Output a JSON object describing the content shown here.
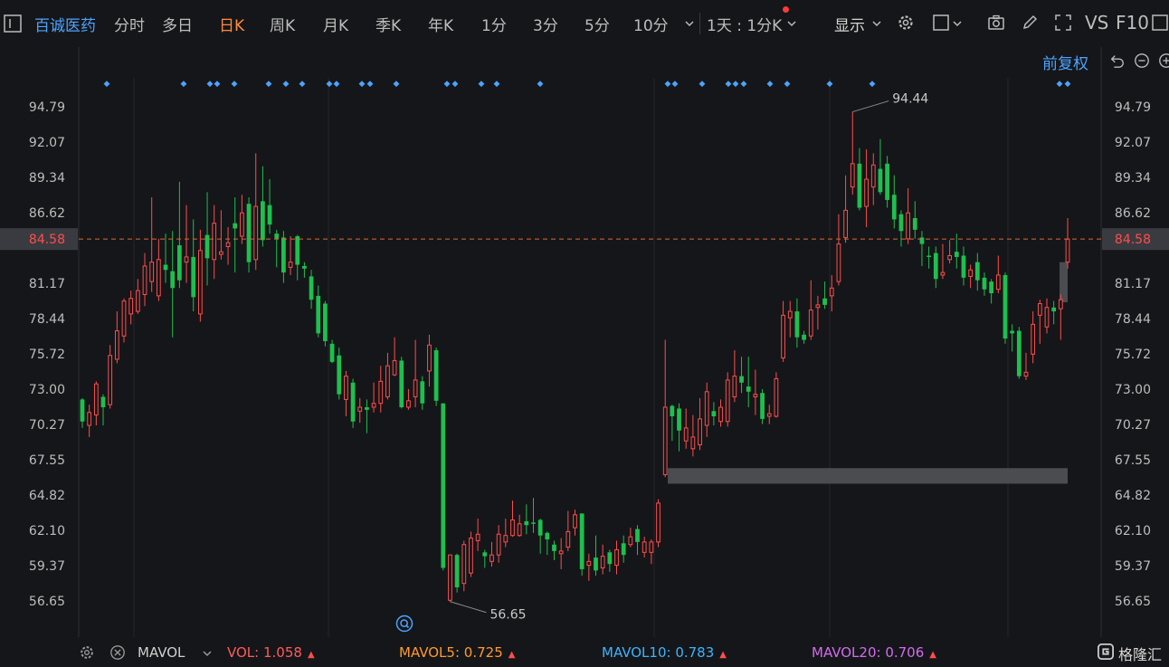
{
  "toolbar": {
    "stock_name": "百诚医药",
    "periods": [
      "分时",
      "多日",
      "日K",
      "周K",
      "月K",
      "季K",
      "年K",
      "1分",
      "3分",
      "5分",
      "10分"
    ],
    "active_period": "日K",
    "interval": "1天 : 1分K",
    "display": "显示",
    "vs": "VS",
    "f10": "F10",
    "adjust": "前复权"
  },
  "chart_data": {
    "type": "candlestick",
    "y_ticks": [
      "94.79",
      "92.07",
      "89.34",
      "86.62",
      "81.17",
      "78.44",
      "75.72",
      "73.00",
      "70.27",
      "67.55",
      "64.82",
      "62.10",
      "59.37",
      "56.65"
    ],
    "ylim": [
      55.2,
      97.4
    ],
    "current_price": "84.58",
    "high_label": "94.44",
    "low_label": "56.65",
    "candles": [
      [
        72.2,
        70.5,
        72.3,
        70.0
      ],
      [
        70.2,
        71.2,
        71.8,
        69.3
      ],
      [
        71.0,
        73.4,
        73.6,
        70.2
      ],
      [
        72.4,
        71.6,
        72.6,
        70.2
      ],
      [
        71.8,
        75.6,
        76.4,
        71.5
      ],
      [
        75.3,
        77.5,
        79.0,
        75.0
      ],
      [
        77.1,
        79.8,
        80.0,
        76.6
      ],
      [
        78.8,
        80.0,
        80.6,
        78.0
      ],
      [
        79.0,
        80.6,
        81.5,
        78.8
      ],
      [
        80.3,
        82.5,
        83.5,
        79.4
      ],
      [
        81.3,
        82.8,
        87.8,
        80.5
      ],
      [
        80.2,
        83.0,
        84.6,
        79.8
      ],
      [
        82.6,
        82.2,
        85.0,
        81.2
      ],
      [
        82.1,
        80.8,
        85.2,
        77.0
      ],
      [
        84.1,
        81.4,
        89.0,
        80.8
      ],
      [
        82.8,
        83.2,
        87.2,
        81.2
      ],
      [
        83.2,
        80.1,
        86.1,
        79.0
      ],
      [
        78.8,
        83.7,
        85.3,
        78.2
      ],
      [
        84.9,
        83.1,
        88.2,
        81.0
      ],
      [
        83.0,
        85.8,
        87.2,
        81.5
      ],
      [
        83.4,
        83.6,
        86.8,
        83.0
      ],
      [
        84.0,
        84.3,
        85.5,
        82.6
      ],
      [
        85.8,
        85.4,
        87.8,
        82.0
      ],
      [
        84.8,
        86.6,
        88.0,
        84.2
      ],
      [
        87.3,
        82.8,
        87.8,
        82.0
      ],
      [
        83.0,
        87.1,
        91.2,
        82.2
      ],
      [
        87.5,
        84.5,
        90.2,
        84.0
      ],
      [
        87.2,
        85.7,
        89.2,
        85.0
      ],
      [
        85.0,
        84.6,
        85.3,
        82.4
      ],
      [
        84.7,
        82.0,
        85.2,
        81.2
      ],
      [
        82.4,
        82.8,
        84.8,
        81.8
      ],
      [
        84.8,
        82.6,
        84.9,
        81.4
      ],
      [
        82.5,
        82.3,
        82.8,
        81.6
      ],
      [
        81.7,
        79.9,
        82.2,
        79.2
      ],
      [
        80.2,
        77.3,
        81.0,
        77.0
      ],
      [
        79.6,
        76.7,
        79.8,
        76.3
      ],
      [
        76.5,
        75.1,
        76.8,
        75.0
      ],
      [
        75.6,
        72.6,
        76.2,
        72.2
      ],
      [
        72.2,
        74.0,
        74.4,
        70.9
      ],
      [
        73.5,
        70.5,
        73.8,
        70.0
      ],
      [
        71.3,
        71.6,
        72.3,
        70.4
      ],
      [
        71.6,
        71.4,
        72.2,
        69.6
      ],
      [
        71.6,
        71.9,
        73.5,
        71.2
      ],
      [
        71.9,
        73.6,
        74.8,
        71.2
      ],
      [
        72.4,
        74.8,
        75.8,
        72.2
      ],
      [
        74.1,
        75.2,
        77.0,
        74.0
      ],
      [
        75.2,
        71.6,
        75.5,
        71.5
      ],
      [
        71.6,
        72.1,
        73.0,
        71.4
      ],
      [
        72.4,
        73.7,
        76.8,
        71.6
      ],
      [
        73.6,
        71.9,
        74.0,
        71.4
      ],
      [
        74.4,
        76.4,
        77.2,
        73.2
      ],
      [
        76.0,
        72.1,
        76.2,
        71.7
      ],
      [
        71.9,
        59.2,
        71.9,
        59.0
      ],
      [
        56.7,
        60.2,
        60.2,
        56.6
      ],
      [
        60.2,
        57.7,
        60.3,
        57.3
      ],
      [
        58.0,
        61.0,
        61.3,
        57.4
      ],
      [
        58.8,
        61.5,
        62.0,
        58.5
      ],
      [
        61.3,
        61.8,
        63.0,
        60.5
      ],
      [
        60.4,
        60.1,
        60.6,
        59.2
      ],
      [
        59.7,
        60.2,
        61.2,
        59.3
      ],
      [
        60.2,
        61.8,
        62.5,
        59.6
      ],
      [
        61.2,
        61.7,
        63.0,
        60.8
      ],
      [
        61.7,
        62.9,
        64.4,
        61.6
      ],
      [
        61.7,
        62.6,
        63.3,
        61.6
      ],
      [
        62.8,
        62.5,
        64.1,
        61.8
      ],
      [
        62.7,
        62.6,
        64.6,
        61.9
      ],
      [
        62.9,
        61.7,
        63.0,
        60.3
      ],
      [
        61.9,
        61.4,
        62.0,
        60.2
      ],
      [
        61.0,
        60.5,
        61.3,
        59.8
      ],
      [
        60.3,
        60.5,
        61.5,
        59.1
      ],
      [
        60.8,
        62.0,
        63.6,
        60.5
      ],
      [
        62.3,
        63.3,
        63.7,
        61.7
      ],
      [
        63.4,
        59.1,
        63.4,
        58.6
      ],
      [
        59.4,
        59.7,
        60.3,
        58.2
      ],
      [
        60.0,
        59.0,
        61.7,
        58.6
      ],
      [
        59.2,
        60.1,
        61.0,
        58.7
      ],
      [
        60.4,
        59.5,
        60.6,
        58.9
      ],
      [
        59.4,
        60.6,
        61.3,
        58.7
      ],
      [
        61.1,
        60.2,
        61.7,
        59.6
      ],
      [
        61.0,
        61.6,
        62.3,
        60.8
      ],
      [
        62.2,
        61.2,
        62.5,
        60.2
      ],
      [
        60.4,
        61.2,
        61.6,
        60.0
      ],
      [
        60.4,
        61.2,
        61.4,
        59.5
      ],
      [
        61.2,
        64.2,
        64.5,
        60.8
      ],
      [
        66.4,
        71.6,
        76.8,
        66.2
      ],
      [
        71.7,
        70.9,
        71.8,
        69.0
      ],
      [
        71.5,
        69.8,
        71.9,
        68.2
      ],
      [
        69.0,
        70.0,
        71.5,
        68.4
      ],
      [
        68.4,
        69.3,
        71.0,
        67.8
      ],
      [
        68.7,
        70.7,
        72.3,
        68.3
      ],
      [
        70.2,
        72.8,
        73.5,
        69.3
      ],
      [
        71.3,
        70.9,
        72.0,
        70.2
      ],
      [
        70.5,
        71.6,
        72.2,
        70.1
      ],
      [
        70.5,
        73.7,
        74.3,
        70.1
      ],
      [
        72.4,
        74.0,
        76.0,
        72.0
      ],
      [
        74.0,
        73.5,
        75.5,
        72.7
      ],
      [
        73.2,
        72.8,
        75.5,
        71.6
      ],
      [
        72.4,
        72.6,
        74.5,
        71.0
      ],
      [
        72.7,
        70.7,
        73.0,
        70.3
      ],
      [
        70.9,
        71.1,
        71.8,
        70.3
      ],
      [
        70.9,
        73.8,
        74.3,
        70.8
      ],
      [
        75.4,
        78.7,
        79.8,
        75.1
      ],
      [
        78.5,
        79.0,
        79.8,
        77.0
      ],
      [
        79.0,
        77.0,
        80.0,
        76.2
      ],
      [
        77.2,
        76.8,
        77.5,
        76.5
      ],
      [
        77.1,
        79.1,
        81.4,
        76.8
      ],
      [
        79.3,
        79.5,
        80.2,
        77.6
      ],
      [
        80.0,
        79.5,
        81.3,
        79.2
      ],
      [
        80.2,
        80.8,
        81.8,
        79.0
      ],
      [
        81.3,
        84.2,
        86.5,
        81.0
      ],
      [
        84.7,
        86.8,
        89.5,
        84.3
      ],
      [
        88.6,
        90.4,
        94.4,
        88.0
      ],
      [
        90.4,
        87.0,
        91.6,
        86.8
      ],
      [
        87.1,
        89.2,
        91.5,
        85.5
      ],
      [
        88.6,
        90.3,
        91.2,
        87.2
      ],
      [
        90.0,
        88.2,
        92.3,
        88.0
      ],
      [
        90.4,
        87.6,
        91.0,
        87.0
      ],
      [
        88.0,
        86.1,
        89.5,
        85.4
      ],
      [
        86.5,
        85.2,
        86.8,
        84.0
      ],
      [
        84.6,
        86.6,
        88.5,
        84.2
      ],
      [
        86.2,
        85.3,
        87.5,
        84.6
      ],
      [
        84.7,
        84.2,
        85.2,
        82.5
      ],
      [
        83.3,
        83.2,
        84.0,
        82.3
      ],
      [
        83.5,
        81.5,
        84.0,
        80.8
      ],
      [
        81.8,
        82.0,
        84.2,
        81.5
      ],
      [
        83.0,
        83.3,
        84.5,
        82.7
      ],
      [
        83.6,
        83.2,
        85.0,
        82.3
      ],
      [
        83.3,
        81.6,
        84.0,
        81.0
      ],
      [
        81.7,
        82.2,
        82.6,
        80.8
      ],
      [
        82.8,
        81.4,
        83.5,
        80.6
      ],
      [
        81.6,
        80.7,
        82.0,
        80.2
      ],
      [
        81.3,
        80.4,
        81.5,
        79.6
      ],
      [
        80.7,
        81.8,
        83.3,
        80.4
      ],
      [
        81.8,
        76.9,
        82.0,
        76.5
      ],
      [
        77.5,
        77.3,
        78.0,
        75.9
      ],
      [
        77.5,
        74.0,
        77.8,
        73.8
      ],
      [
        74.0,
        74.3,
        75.8,
        73.7
      ],
      [
        75.7,
        78.0,
        79.0,
        75.0
      ],
      [
        78.7,
        79.6,
        79.9,
        76.5
      ],
      [
        77.8,
        79.3,
        80.0,
        77.3
      ],
      [
        79.3,
        79.0,
        79.8,
        78.0
      ],
      [
        79.2,
        79.9,
        80.3,
        76.8
      ],
      [
        82.8,
        84.58,
        86.2,
        82.3
      ]
    ],
    "markers": [
      "◆",
      "◆",
      "◆",
      "◆",
      "◆",
      "◆",
      "◆",
      "◆",
      "◆",
      "◆",
      "◆",
      "◆",
      "◆",
      "◆",
      "◆",
      "◆",
      "◆",
      "◆",
      "◆",
      "◆",
      "◆",
      "◆",
      "◆",
      "◆",
      "◆",
      "◆",
      "◆",
      "◆",
      "◆",
      "◆",
      "◆",
      "◆",
      "◆"
    ],
    "indicator_name": "MAVOL",
    "vol": {
      "label": "VOL:",
      "value": "1.058"
    },
    "mavol5": {
      "label": "MAVOL5:",
      "value": "0.725"
    },
    "mavol10": {
      "label": "MAVOL10:",
      "value": "0.783"
    },
    "mavol20": {
      "label": "MAVOL20:",
      "value": "0.706"
    }
  },
  "brand": "格隆汇",
  "colors": {
    "up": "#ff4d4d",
    "down": "#1fbf4f",
    "blue": "#4da3ff",
    "active": "#ff8a3d",
    "mavol5": "#ff9a2e",
    "mavol10": "#3db4ff",
    "mavol20": "#d36bf0"
  }
}
